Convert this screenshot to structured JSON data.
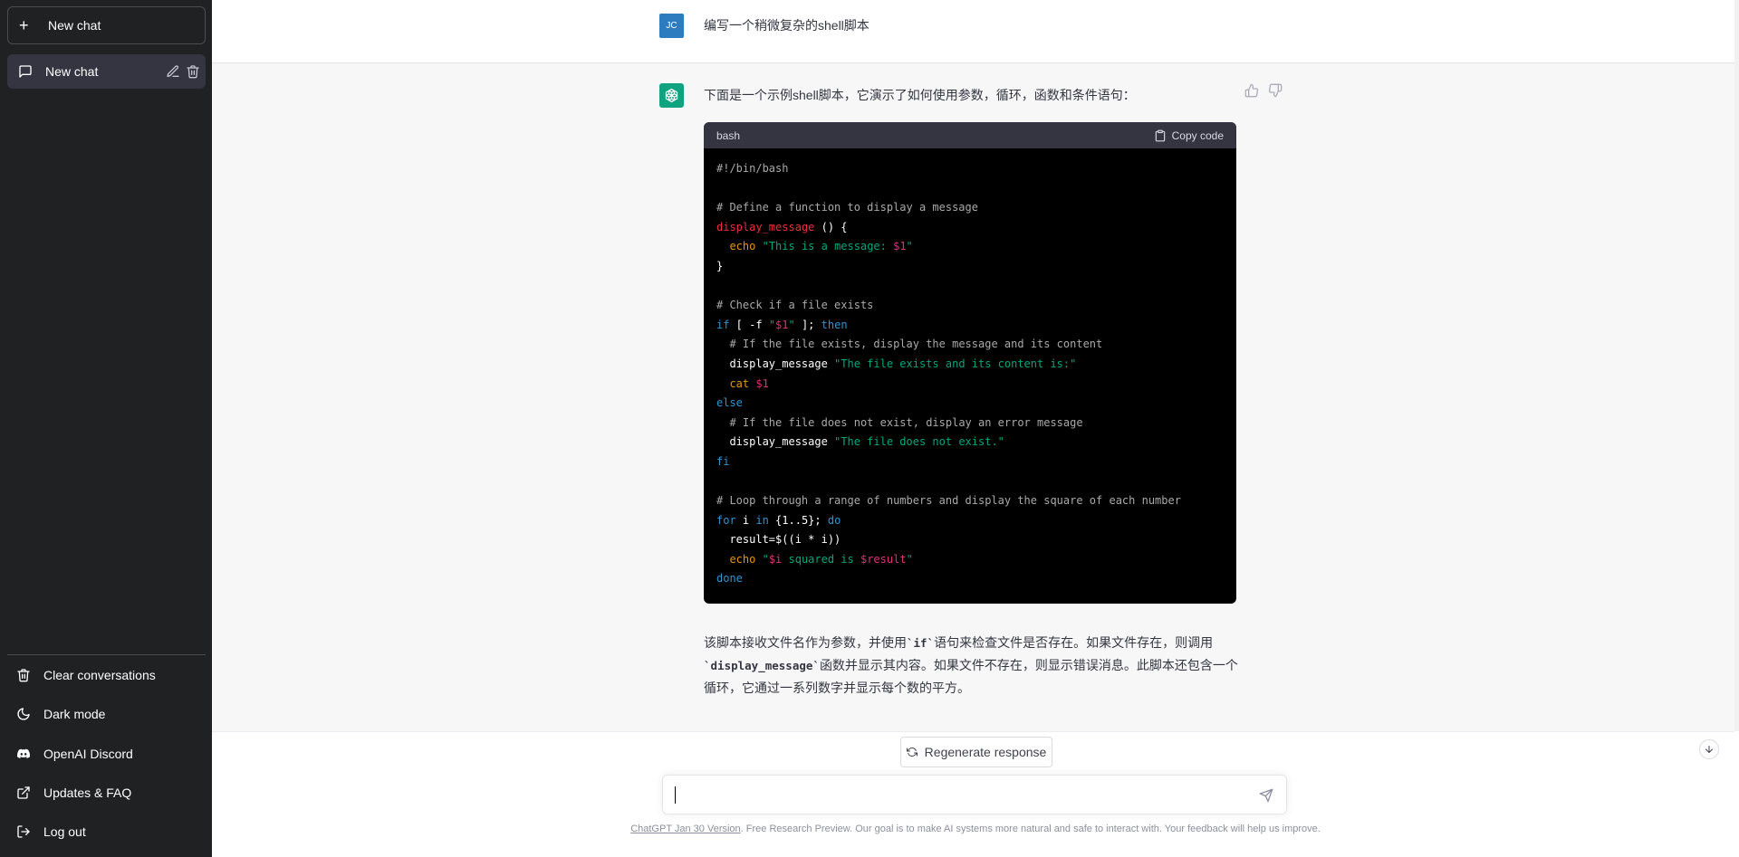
{
  "sidebar": {
    "new_chat_label": "New chat",
    "chats": [
      {
        "label": "New chat"
      }
    ],
    "links": [
      {
        "label": "Clear conversations",
        "icon": "trash-icon"
      },
      {
        "label": "Dark mode",
        "icon": "moon-icon"
      },
      {
        "label": "OpenAI Discord",
        "icon": "discord-icon"
      },
      {
        "label": "Updates & FAQ",
        "icon": "external-link-icon"
      },
      {
        "label": "Log out",
        "icon": "logout-icon"
      }
    ]
  },
  "conversation": {
    "user": {
      "initials": "JC",
      "message": "编写一个稍微复杂的shell脚本"
    },
    "assistant": {
      "intro": "下面是一个示例shell脚本，它演示了如何使用参数，循环，函数和条件语句：",
      "code_language": "bash",
      "copy_label": "Copy code",
      "explanation": {
        "part1": "该脚本接收文件名作为参数，并使用",
        "code1": "`if`",
        "part2": "语句来检查文件是否存在。如果文件存在，则调用",
        "code2": "`display_message`",
        "part3": "函数并显示其内容。如果文件不存在，则显示错误消息。此脚本还包含一个循环，它通过一系列数字并显示每个数的平方。"
      }
    }
  },
  "composer": {
    "regenerate_label": "Regenerate response",
    "placeholder": "",
    "footer_link": "ChatGPT Jan 30 Version",
    "footer_text": ". Free Research Preview. Our goal is to make AI systems more natural and safe to interact with. Your feedback will help us improve."
  },
  "colors": {
    "sidebar_bg": "#202123",
    "accent": "#10a37f",
    "user_avatar": "#2e7cc0"
  }
}
